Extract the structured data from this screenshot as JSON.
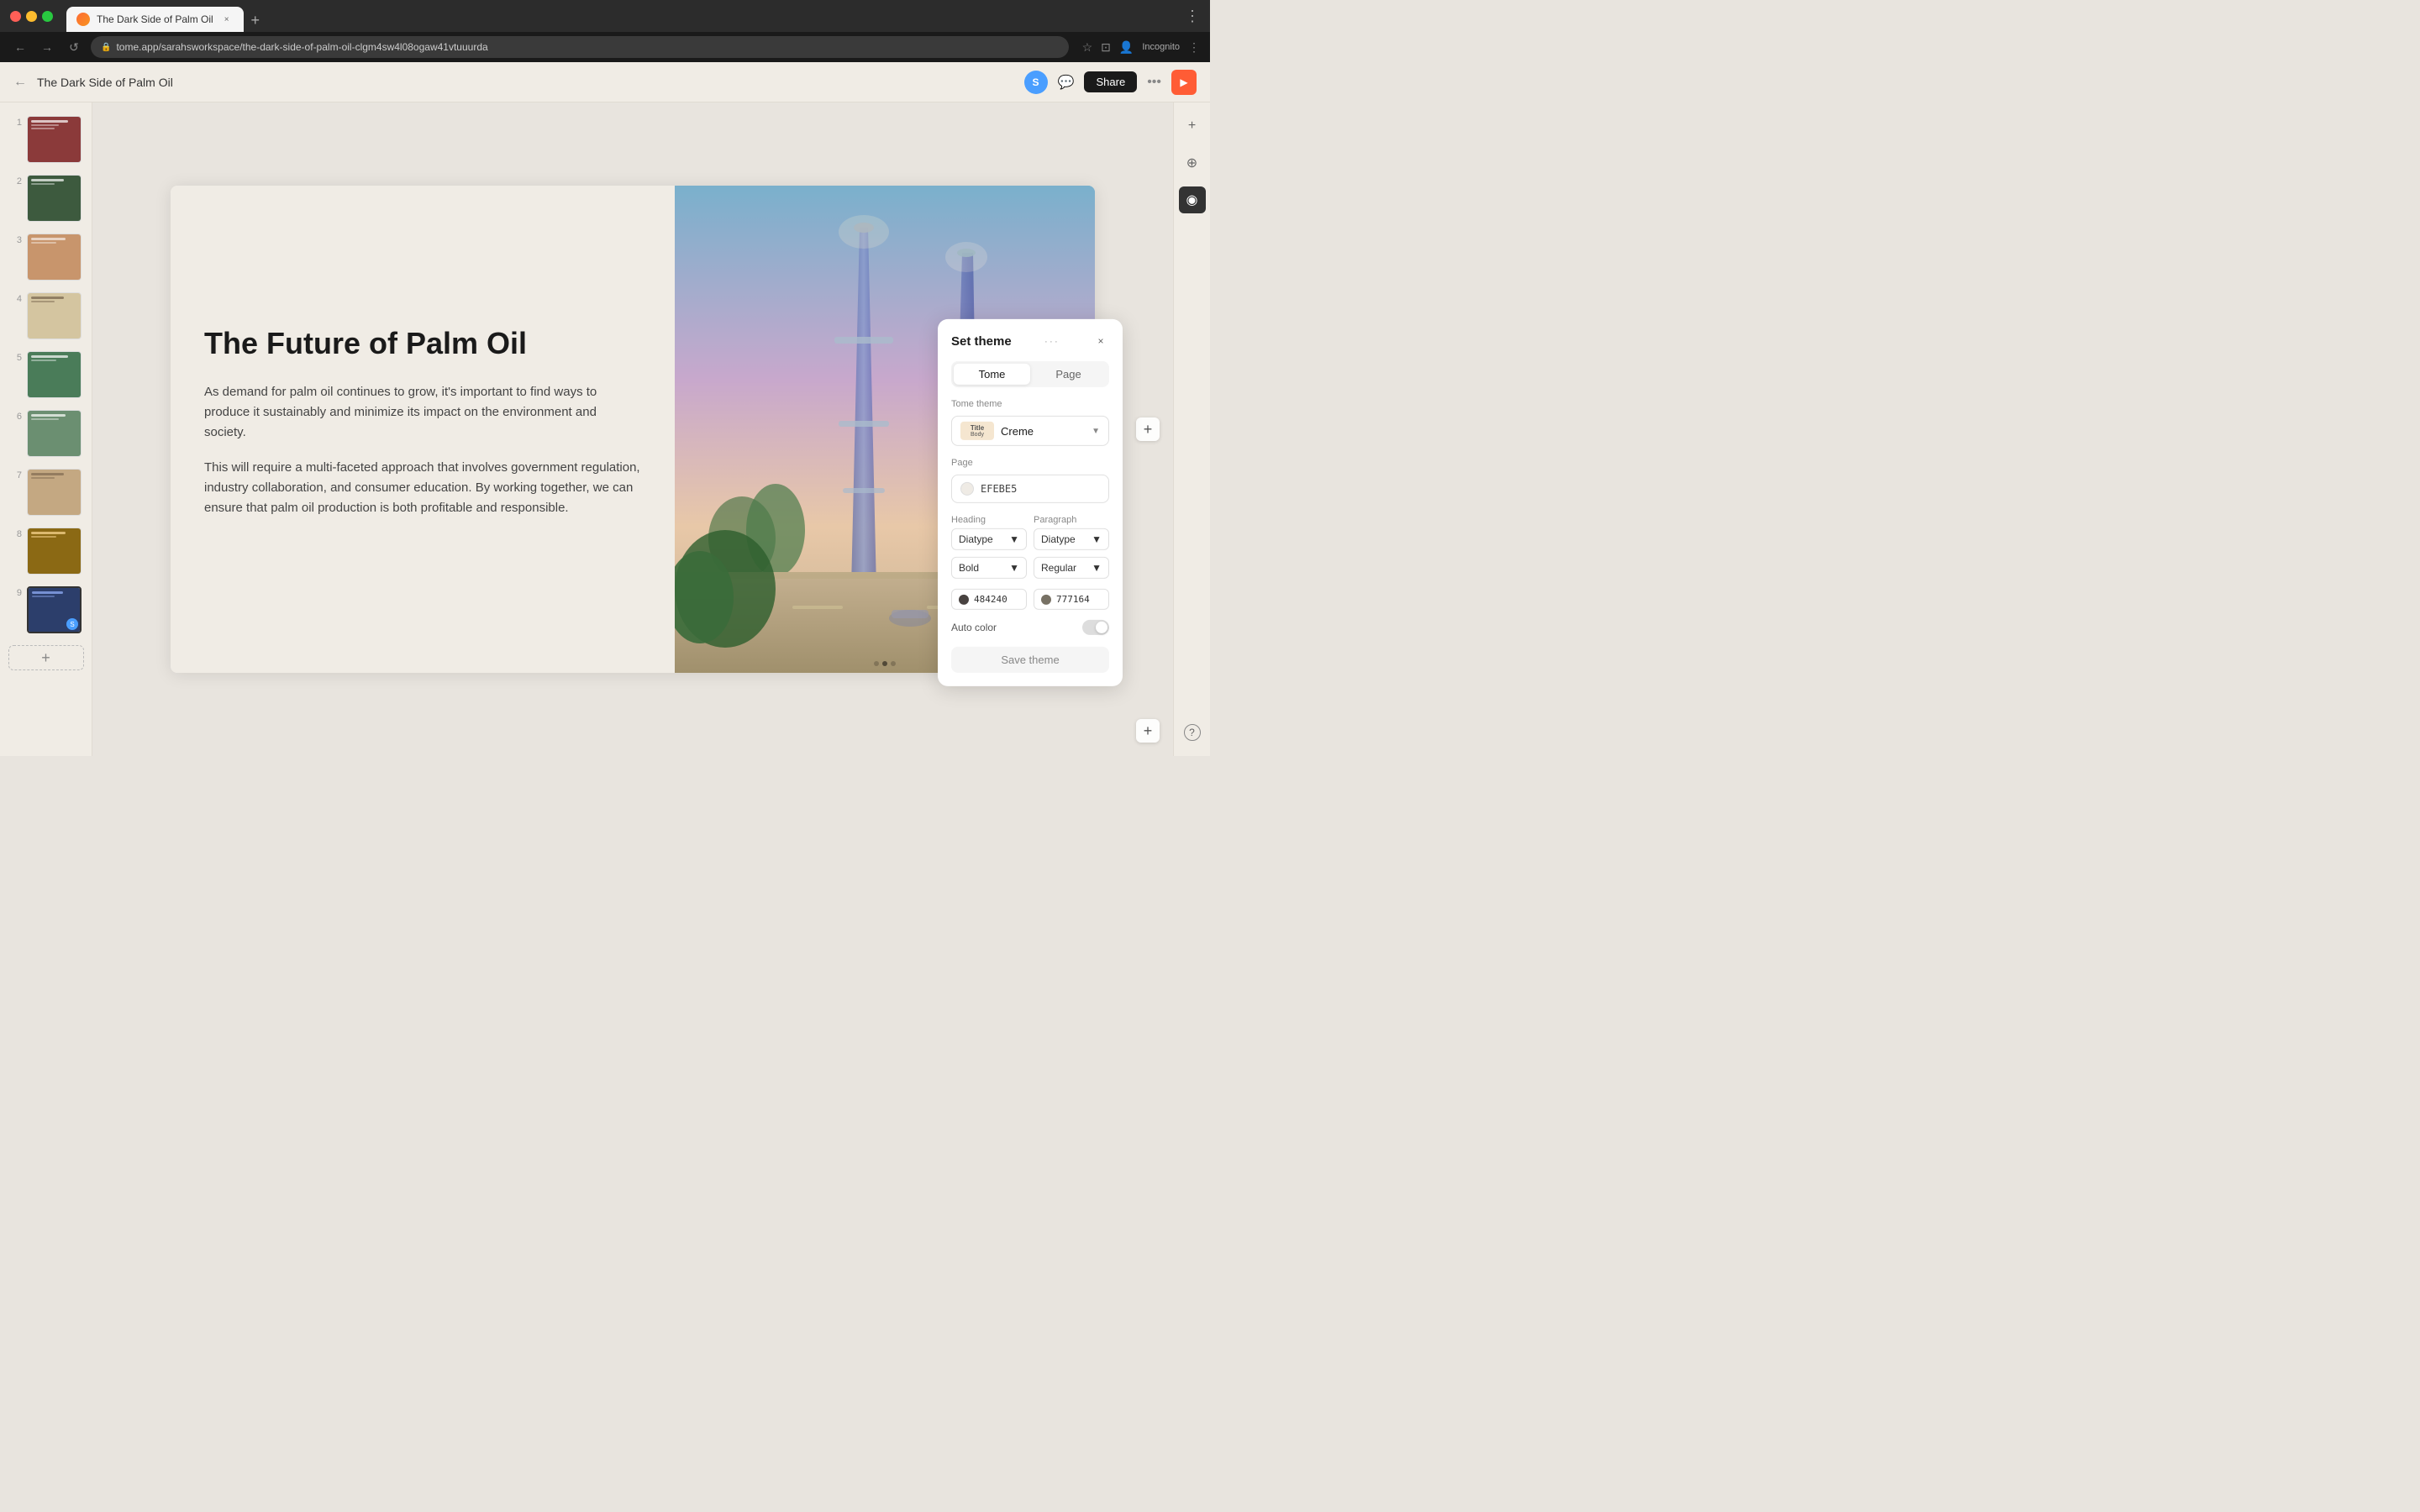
{
  "browser": {
    "tab_title": "The Dark Side of Palm Oil",
    "url": "tome.app/sarahsworkspace/the-dark-side-of-palm-oil-clgm4sw4l08ogaw41vtuuurda",
    "tab_close": "×",
    "tab_new": "+",
    "nav_back": "←",
    "nav_forward": "→",
    "nav_refresh": "↺",
    "lock_icon": "🔒",
    "profile": "Incognito",
    "browser_more": "⋮"
  },
  "app_header": {
    "back_icon": "←",
    "title": "The Dark Side of Palm Oil",
    "avatar": "S",
    "share_label": "Share",
    "dots": "•••",
    "play_icon": "▶"
  },
  "slide": {
    "heading": "The Future of Palm Oil",
    "para1": "As demand for palm oil continues to grow, it's important to find ways to produce it sustainably and minimize its impact on the environment and society.",
    "para2": "This will require a multi-faceted approach that involves government regulation, industry collaboration, and consumer education. By working together, we can ensure that palm oil production is both profitable and responsible."
  },
  "sidebar": {
    "slides": [
      {
        "num": "1",
        "color": "#8b3a3a"
      },
      {
        "num": "2",
        "color": "#3d5a3e"
      },
      {
        "num": "3",
        "color": "#c8956c"
      },
      {
        "num": "4",
        "color": "#d4c5a0"
      },
      {
        "num": "5",
        "color": "#4a7c59"
      },
      {
        "num": "6",
        "color": "#6b8f71"
      },
      {
        "num": "7",
        "color": "#c4a882"
      },
      {
        "num": "8",
        "color": "#8b6914"
      },
      {
        "num": "9",
        "color": "#2c3e6b"
      }
    ],
    "add_slide_icon": "+"
  },
  "theme_panel": {
    "title": "Set theme",
    "drag_icon": "···",
    "close": "×",
    "tabs": [
      "Tome",
      "Page"
    ],
    "active_tab": "Tome",
    "tome_theme_label": "Tome theme",
    "dropdown_preview_title": "Title",
    "dropdown_preview_body": "Body",
    "dropdown_label": "Creme",
    "page_section_label": "Page",
    "page_color_value": "EFEBE5",
    "heading_label": "Heading",
    "paragraph_label": "Paragraph",
    "heading_font": "Diatype",
    "paragraph_font": "Diatype",
    "heading_weight": "Bold",
    "paragraph_weight": "Regular",
    "heading_color": "484240",
    "paragraph_color": "777164",
    "auto_color_label": "Auto color",
    "save_label": "Save theme"
  },
  "right_panel": {
    "plus_icon": "+",
    "crosshair_icon": "⊕",
    "theme_icon": "◉"
  },
  "colors": {
    "heading_dot": "#484240",
    "paragraph_dot": "#777164",
    "page_swatch": "#efebe5"
  }
}
